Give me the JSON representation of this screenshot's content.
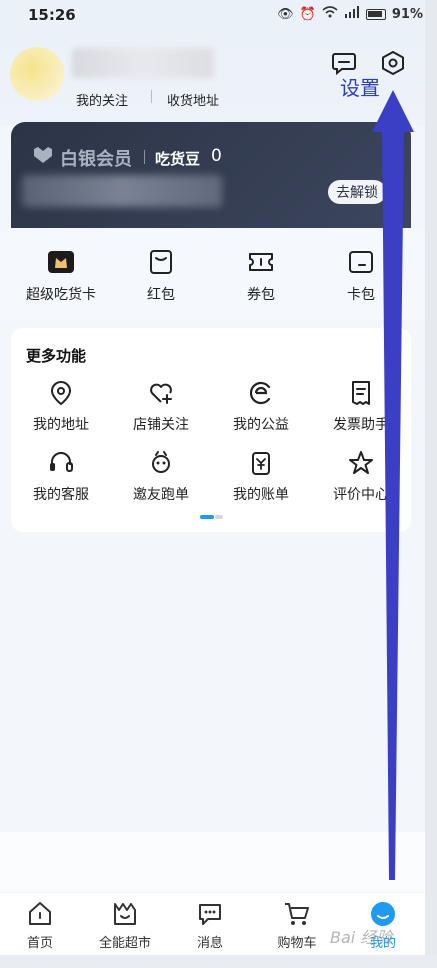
{
  "status_bar": {
    "time": "15:26",
    "battery": "91%"
  },
  "header": {
    "link_follow": "我的关注",
    "link_address": "收货地址",
    "settings_annotation": "设置"
  },
  "member_card": {
    "title": "白银会员",
    "beans_label": "吃货豆",
    "beans_value": "0",
    "unlock_button": "去解锁"
  },
  "quick_tools": [
    {
      "label": "超级吃货卡",
      "icon": "food-card-icon"
    },
    {
      "label": "红包",
      "icon": "red-packet-icon"
    },
    {
      "label": "券包",
      "icon": "coupon-icon"
    },
    {
      "label": "卡包",
      "icon": "card-wallet-icon"
    }
  ],
  "more_functions": {
    "title": "更多功能",
    "items": [
      {
        "label": "我的地址",
        "icon": "location-pin-icon"
      },
      {
        "label": "店铺关注",
        "icon": "heart-plus-icon"
      },
      {
        "label": "我的公益",
        "icon": "charity-icon"
      },
      {
        "label": "发票助手",
        "icon": "invoice-icon"
      },
      {
        "label": "我的客服",
        "icon": "headset-icon"
      },
      {
        "label": "邀友跑单",
        "icon": "invite-friend-icon"
      },
      {
        "label": "我的账单",
        "icon": "bill-yen-icon"
      },
      {
        "label": "评价中心",
        "icon": "star-icon"
      }
    ]
  },
  "bottom_nav": [
    {
      "label": "首页",
      "icon": "home-icon"
    },
    {
      "label": "全能超市",
      "icon": "supermarket-icon"
    },
    {
      "label": "消息",
      "icon": "message-icon"
    },
    {
      "label": "购物车",
      "icon": "cart-icon"
    },
    {
      "label": "我的",
      "icon": "profile-icon",
      "active": true
    }
  ],
  "colors": {
    "accent_blue": "#1e9bf0",
    "annotation_blue": "#2d3fb6",
    "card_dark": "#2c3447"
  },
  "watermark": "Bai 经验"
}
